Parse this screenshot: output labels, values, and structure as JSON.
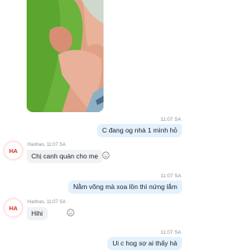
{
  "messages": [
    {
      "type": "image",
      "direction": "outgoing",
      "image_icon": "photo"
    },
    {
      "type": "text",
      "direction": "outgoing",
      "time": "11:07 SA",
      "text": "C đang og nhà 1 mình hỏ"
    },
    {
      "type": "text",
      "direction": "incoming",
      "avatar": "HA",
      "sender": "Hanhan",
      "time": "11:07 SA",
      "text": "Chị canh quán cho mẹ",
      "reaction_icon": "smiley-icon"
    },
    {
      "type": "text",
      "direction": "outgoing",
      "time": "11:07 SA",
      "text": "Nằm võng mà xoa lồn thì nứng lắm"
    },
    {
      "type": "text",
      "direction": "incoming",
      "avatar": "HA",
      "sender": "Hanhan",
      "time": "11:07 SA",
      "text": "Hihi",
      "reaction_icon": "smiley-icon"
    },
    {
      "type": "text",
      "direction": "outgoing",
      "time": "11:07 SA",
      "text": "Ui c hog sợ ai thấy hả"
    }
  ],
  "colors": {
    "outgoing_bubble": "#e3f1fd",
    "incoming_bubble": "#f1f2f4",
    "avatar_text": "#e0281e",
    "timestamp": "#8a8f96"
  }
}
